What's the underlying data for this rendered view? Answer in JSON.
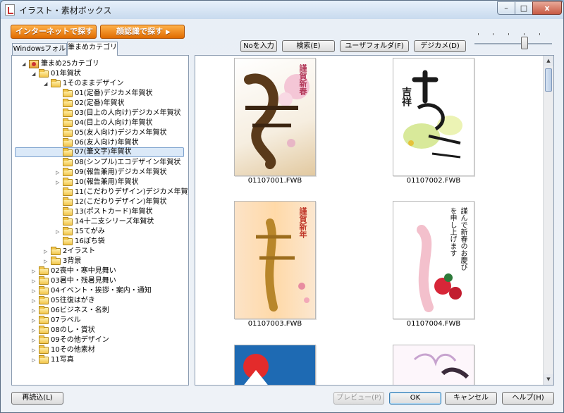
{
  "window": {
    "title": "イラスト・素材ボックス",
    "min_label": "–",
    "max_label": "□",
    "close_label": "x"
  },
  "toolbar": {
    "internet_search": "インターネットで探す",
    "face_search": "顔認識で探す",
    "no_input": "Noを入力",
    "search": "検索(E)",
    "user_folder": "ユーザフォルダ(F)",
    "digicam": "デジカメ(D)"
  },
  "tabs": [
    {
      "label": "Windowsフォルダ"
    },
    {
      "label": "筆まめカテゴリ"
    }
  ],
  "tree": [
    {
      "label": "筆まめ25カテゴリ",
      "exp": "◢",
      "kind": "root"
    },
    {
      "label": "01年賀状",
      "exp": "◢"
    },
    {
      "label": "1そのままデザイン",
      "exp": "◢"
    },
    {
      "label": "01(定番)デジカメ年賀状",
      "exp": ""
    },
    {
      "label": "02(定番)年賀状",
      "exp": ""
    },
    {
      "label": "03(目上の人向け)デジカメ年賀状",
      "exp": ""
    },
    {
      "label": "04(目上の人向け)年賀状",
      "exp": ""
    },
    {
      "label": "05(友人向け)デジカメ年賀状",
      "exp": ""
    },
    {
      "label": "06(友人向け)年賀状",
      "exp": ""
    },
    {
      "label": "07(筆文字)年賀状",
      "exp": "",
      "selected": true
    },
    {
      "label": "08(シンプル)エコデザイン年賀状",
      "exp": ""
    },
    {
      "label": "09(報告兼用)デジカメ年賀状",
      "exp": "▷"
    },
    {
      "label": "10(報告兼用)年賀状",
      "exp": "▷"
    },
    {
      "label": "11(こだわりデザイン)デジカメ年賀状",
      "exp": ""
    },
    {
      "label": "12(こだわりデザイン)年賀状",
      "exp": ""
    },
    {
      "label": "13(ポストカード)年賀状",
      "exp": ""
    },
    {
      "label": "14十二支シリーズ年賀状",
      "exp": ""
    },
    {
      "label": "15てがみ",
      "exp": "▷"
    },
    {
      "label": "16ぽち袋",
      "exp": ""
    },
    {
      "label": "2イラスト",
      "exp": "▷"
    },
    {
      "label": "3背景",
      "exp": "▷"
    },
    {
      "label": "02喪中・寒中見舞い",
      "exp": "▷"
    },
    {
      "label": "03暑中・残暑見舞い",
      "exp": "▷"
    },
    {
      "label": "04イベント・挨拶・案内・通知",
      "exp": "▷"
    },
    {
      "label": "05往復はがき",
      "exp": "▷"
    },
    {
      "label": "06ビジネス・名刺",
      "exp": "▷"
    },
    {
      "label": "07ラベル",
      "exp": "▷"
    },
    {
      "label": "08のし・賞状",
      "exp": "▷"
    },
    {
      "label": "09その他デザイン",
      "exp": "▷"
    },
    {
      "label": "10その他素材",
      "exp": "▷"
    },
    {
      "label": "11写真",
      "exp": "▷"
    }
  ],
  "thumbnails": [
    {
      "file": "01107001.FWB",
      "text": "謹賀新春",
      "glyph": "寿"
    },
    {
      "file": "01107002.FWB",
      "text": "吉祥",
      "glyph": "吉"
    },
    {
      "file": "01107003.FWB",
      "text": "謹賀新年",
      "glyph": "年"
    },
    {
      "file": "01107004.FWB",
      "text": "謹んで新春のお慶びを申し上げます",
      "glyph": "年"
    },
    {
      "file": "",
      "text": "",
      "glyph": ""
    },
    {
      "file": "",
      "text": "",
      "glyph": ""
    }
  ],
  "footer": {
    "reload": "再読込(L)",
    "preview": "プレビュー(P)",
    "ok": "OK",
    "cancel": "キャンセル",
    "help": "ヘルプ(H)"
  }
}
